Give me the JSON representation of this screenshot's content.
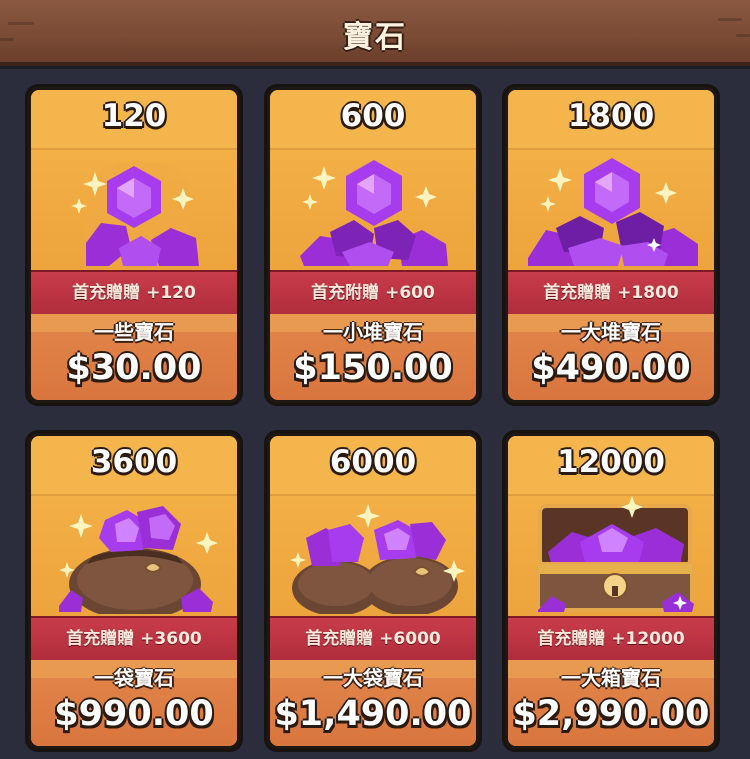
{
  "header": {
    "title": "寶石"
  },
  "colors": {
    "gold": "#f5b64a",
    "ribbon": "#c83c4a",
    "footer": "#d9753f",
    "gem": "#a83cf0",
    "background": "#2b2d3c"
  },
  "cards": [
    {
      "amount": "120",
      "bonus": "首充贈贈 +120",
      "name": "一些寶石",
      "price": "$30.00",
      "art": "gem-pile-small"
    },
    {
      "amount": "600",
      "bonus": "首充附贈 +600",
      "name": "一小堆寶石",
      "price": "$150.00",
      "art": "gem-pile-medium"
    },
    {
      "amount": "1800",
      "bonus": "首充贈贈 +1800",
      "name": "一大堆寶石",
      "price": "$490.00",
      "art": "gem-pile-large"
    },
    {
      "amount": "3600",
      "bonus": "首充贈贈 +3600",
      "name": "一袋寶石",
      "price": "$990.00",
      "art": "gem-bag"
    },
    {
      "amount": "6000",
      "bonus": "首充贈贈 +6000",
      "name": "一大袋寶石",
      "price": "$1,490.00",
      "art": "gem-bags"
    },
    {
      "amount": "12000",
      "bonus": "首充贈贈 +12000",
      "name": "一大箱寶石",
      "price": "$2,990.00",
      "art": "gem-chest"
    }
  ]
}
